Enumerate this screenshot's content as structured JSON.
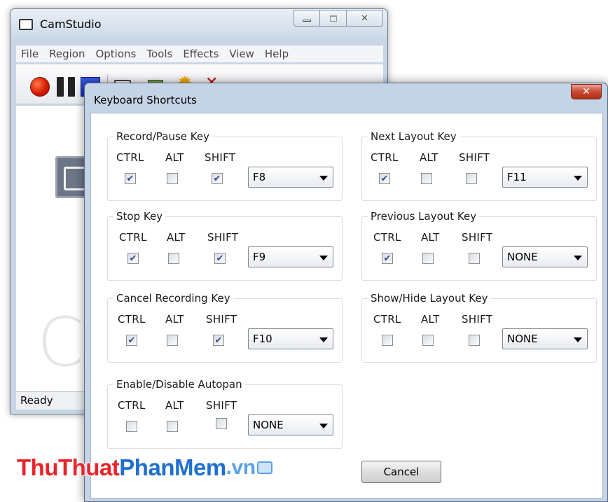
{
  "main_window": {
    "title": "CamStudio",
    "menu": [
      "File",
      "Region",
      "Options",
      "Tools",
      "Effects",
      "View",
      "Help"
    ],
    "body_text": "Ca",
    "status": "Ready"
  },
  "dialog": {
    "title": "Keyboard Shortcuts",
    "close_glyph": "✕",
    "modifier_labels": [
      "CTRL",
      "ALT",
      "SHIFT"
    ],
    "groups": [
      {
        "title": "Record/Pause Key",
        "ctrl": true,
        "alt": false,
        "shift": true,
        "key": "F8"
      },
      {
        "title": "Next Layout Key",
        "ctrl": true,
        "alt": false,
        "shift": false,
        "key": "F11"
      },
      {
        "title": "Stop Key",
        "ctrl": true,
        "alt": false,
        "shift": true,
        "key": "F9"
      },
      {
        "title": "Previous Layout Key",
        "ctrl": true,
        "alt": false,
        "shift": false,
        "key": "NONE"
      },
      {
        "title": "Cancel Recording Key",
        "ctrl": true,
        "alt": false,
        "shift": true,
        "key": "F10"
      },
      {
        "title": "Show/Hide Layout Key",
        "ctrl": false,
        "alt": false,
        "shift": false,
        "key": "NONE"
      },
      {
        "title": "Enable/Disable Autopan",
        "ctrl": false,
        "alt": false,
        "shift": false,
        "key": "NONE"
      }
    ],
    "cancel_label": "Cancel"
  },
  "watermark": {
    "part1": "ThuThuat",
    "part2": "PhanMem",
    "part3": ".vn"
  },
  "colors": {
    "dialog_frame": "#c4d3e6",
    "close_button": "#c7472f",
    "check_mark": "#2a4e95",
    "watermark_red": "#e8252c",
    "watermark_blue": "#1e6fd0"
  }
}
